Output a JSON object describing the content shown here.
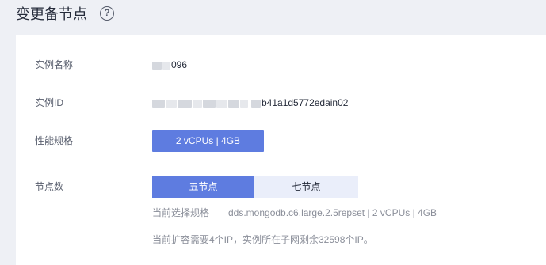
{
  "header": {
    "title": "变更备节点",
    "help_glyph": "?"
  },
  "form": {
    "instance_name": {
      "label": "实例名称",
      "value_suffix": "096"
    },
    "instance_id": {
      "label": "实例ID",
      "value_suffix": "b41a1d5772edain02"
    },
    "performance_spec": {
      "label": "性能规格",
      "button_label": "2 vCPUs | 4GB"
    },
    "node_count": {
      "label": "节点数",
      "options": [
        {
          "label": "五节点",
          "selected": true
        },
        {
          "label": "七节点",
          "selected": false
        }
      ]
    },
    "current_spec": {
      "label": "当前选择规格",
      "value": "dds.mongodb.c6.large.2.5repset | 2 vCPUs | 4GB"
    },
    "ip_note": "当前扩容需要4个IP，实例所在子网剩余32598个IP。"
  },
  "colors": {
    "accent": "#5e7ce0",
    "accent_light": "#eaeefa",
    "page_bg": "#eef0f5",
    "card_bg": "#ffffff"
  },
  "icons": {
    "help": "help-circle-icon"
  }
}
